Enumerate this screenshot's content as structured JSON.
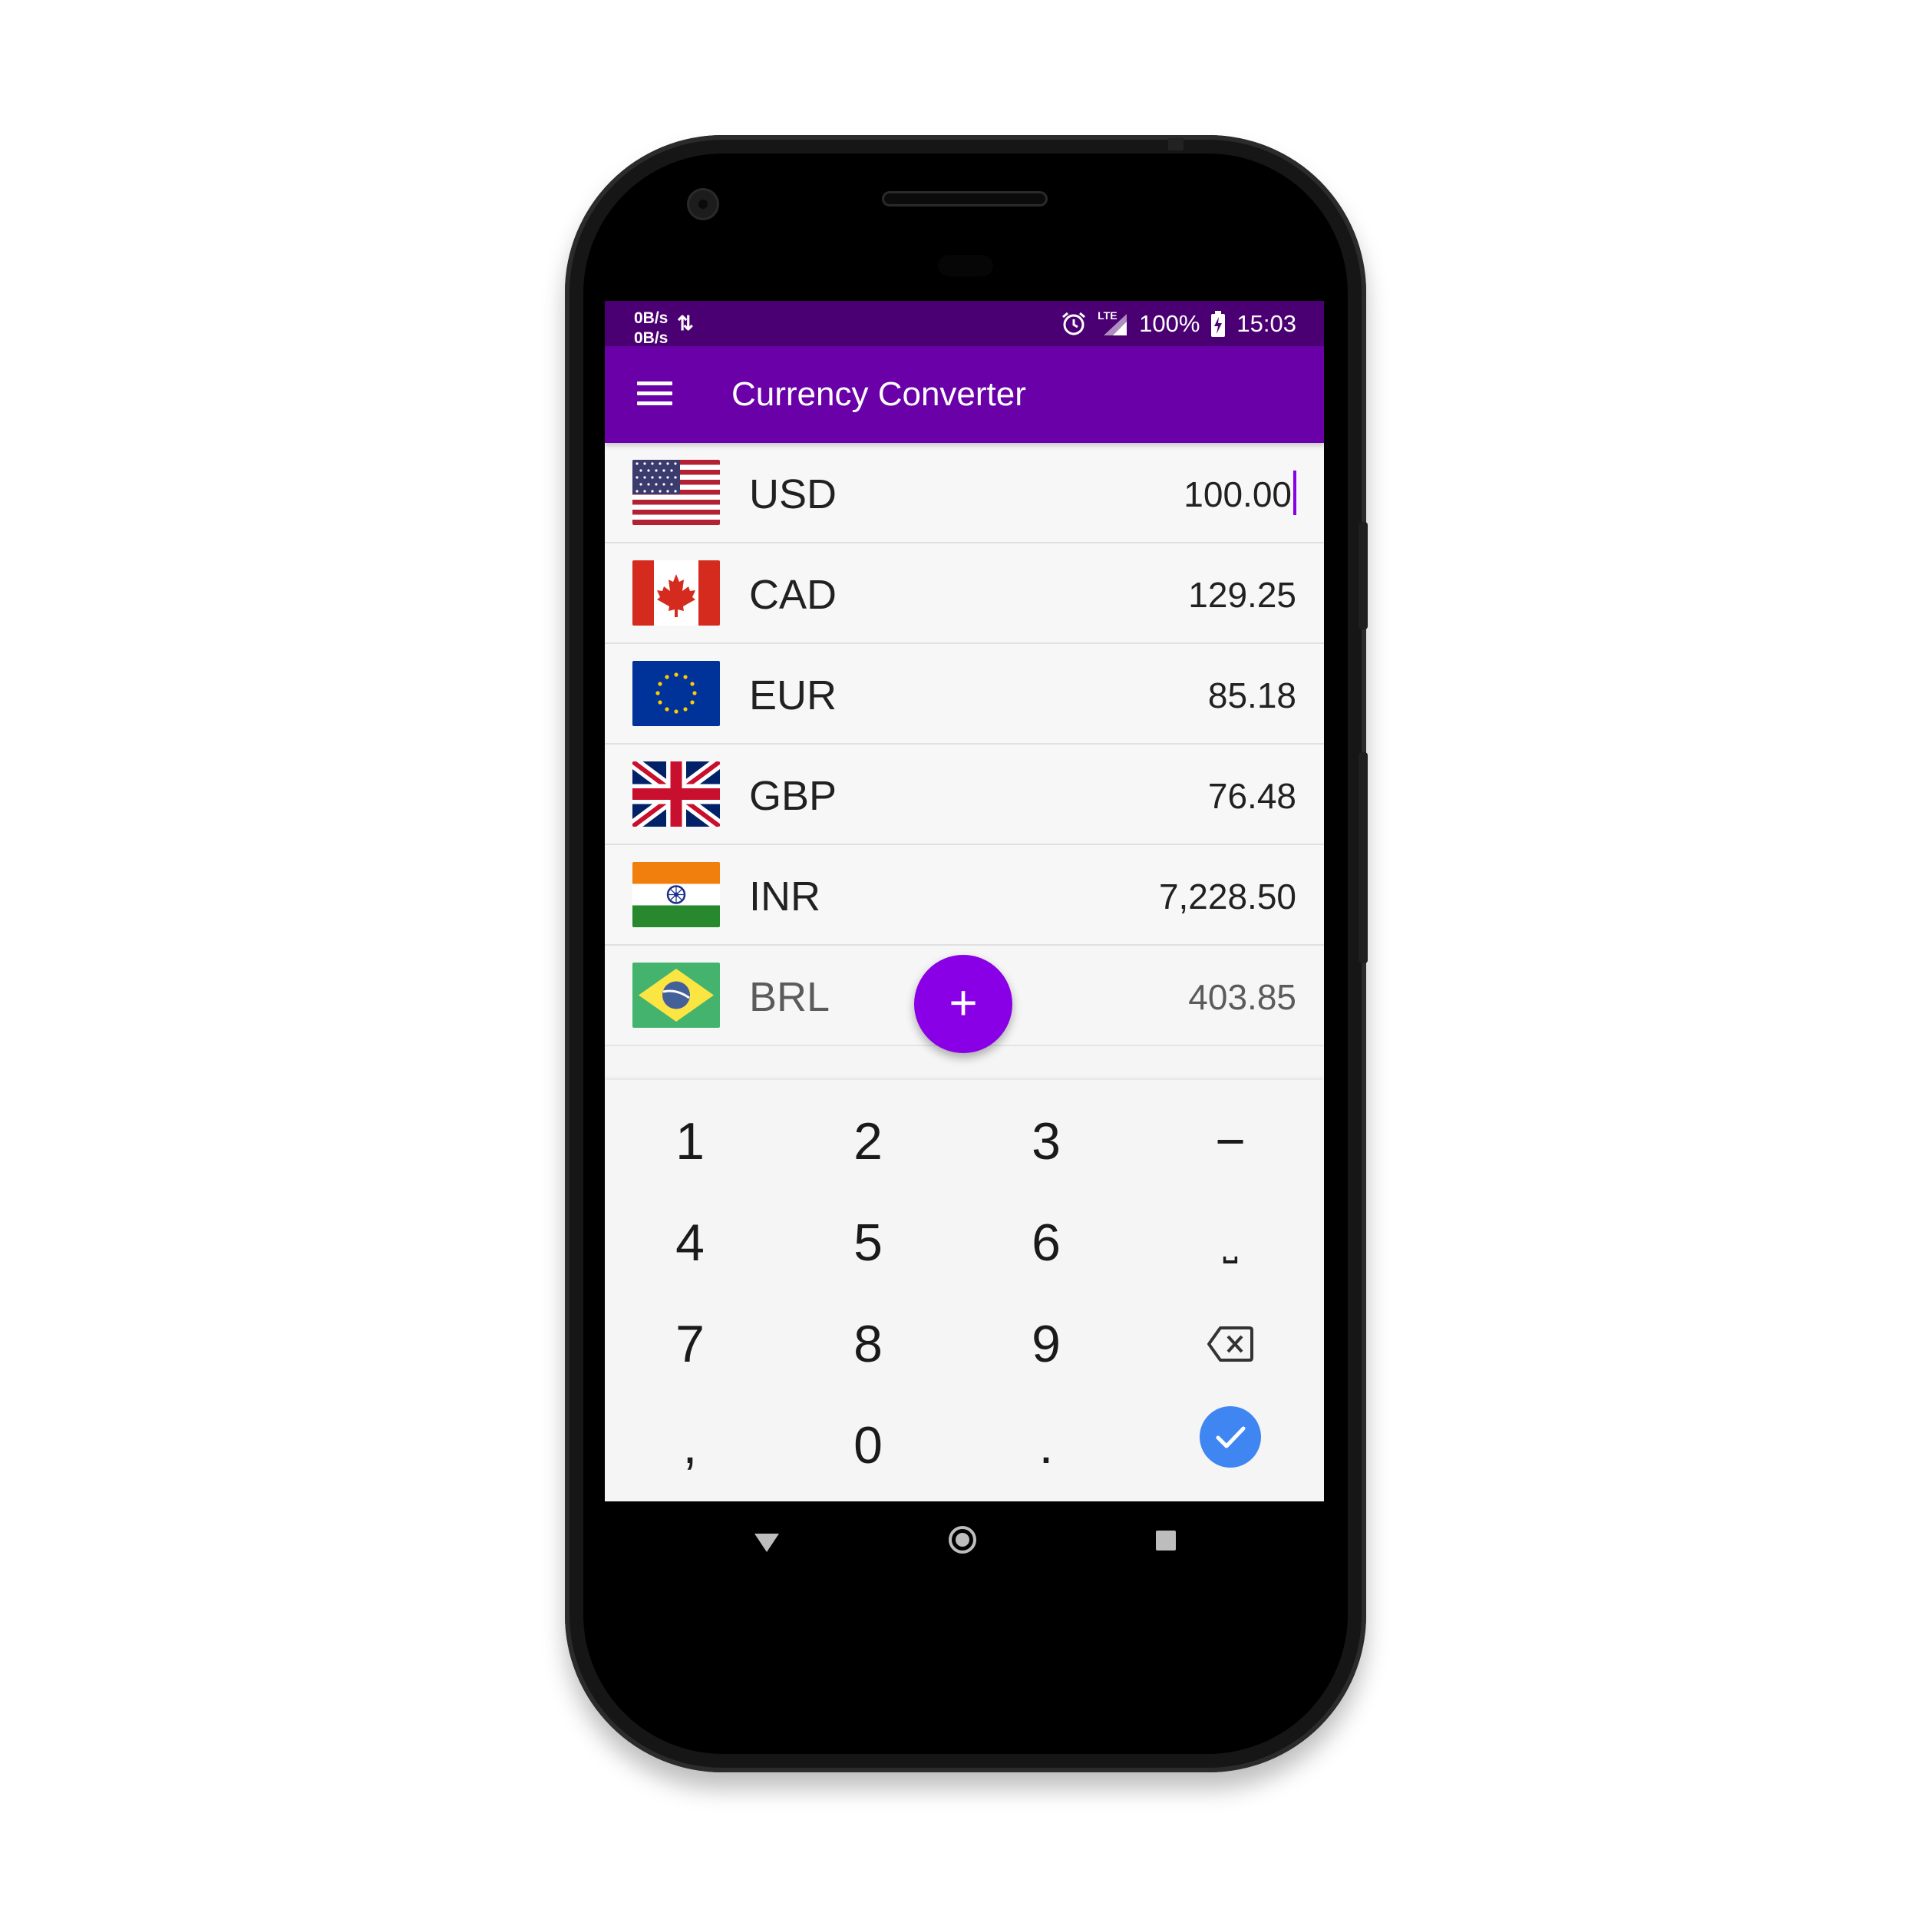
{
  "status_bar": {
    "net_up": "0B/s",
    "net_down": "0B/s",
    "network_type": "LTE",
    "battery": "100%",
    "time": "15:03"
  },
  "app_bar": {
    "title": "Currency Converter",
    "menu_icon": "hamburger-menu-icon"
  },
  "currencies": [
    {
      "code": "USD",
      "amount": "100.00",
      "flag": "us-flag",
      "active": true
    },
    {
      "code": "CAD",
      "amount": "129.25",
      "flag": "canada-flag"
    },
    {
      "code": "EUR",
      "amount": "85.18",
      "flag": "eu-flag"
    },
    {
      "code": "GBP",
      "amount": "76.48",
      "flag": "uk-flag"
    },
    {
      "code": "INR",
      "amount": "7,228.50",
      "flag": "india-flag"
    },
    {
      "code": "BRL",
      "amount": "403.85",
      "flag": "brazil-flag"
    }
  ],
  "fab": {
    "label": "+"
  },
  "keypad": {
    "keys": [
      "1",
      "2",
      "3",
      "−",
      "4",
      "5",
      "6",
      "⎵",
      "7",
      "8",
      "9",
      "⌫",
      ",",
      "0",
      "."
    ],
    "enter_icon": "check-icon",
    "enter_color": "#3f86f2"
  },
  "colors": {
    "primary": "#6a00a8",
    "primary_dark": "#4a0072",
    "accent": "#8a00e6"
  },
  "nav_bar": {
    "back_icon": "back-triangle-icon",
    "home_icon": "home-circle-icon",
    "recents_icon": "recents-square-icon"
  }
}
